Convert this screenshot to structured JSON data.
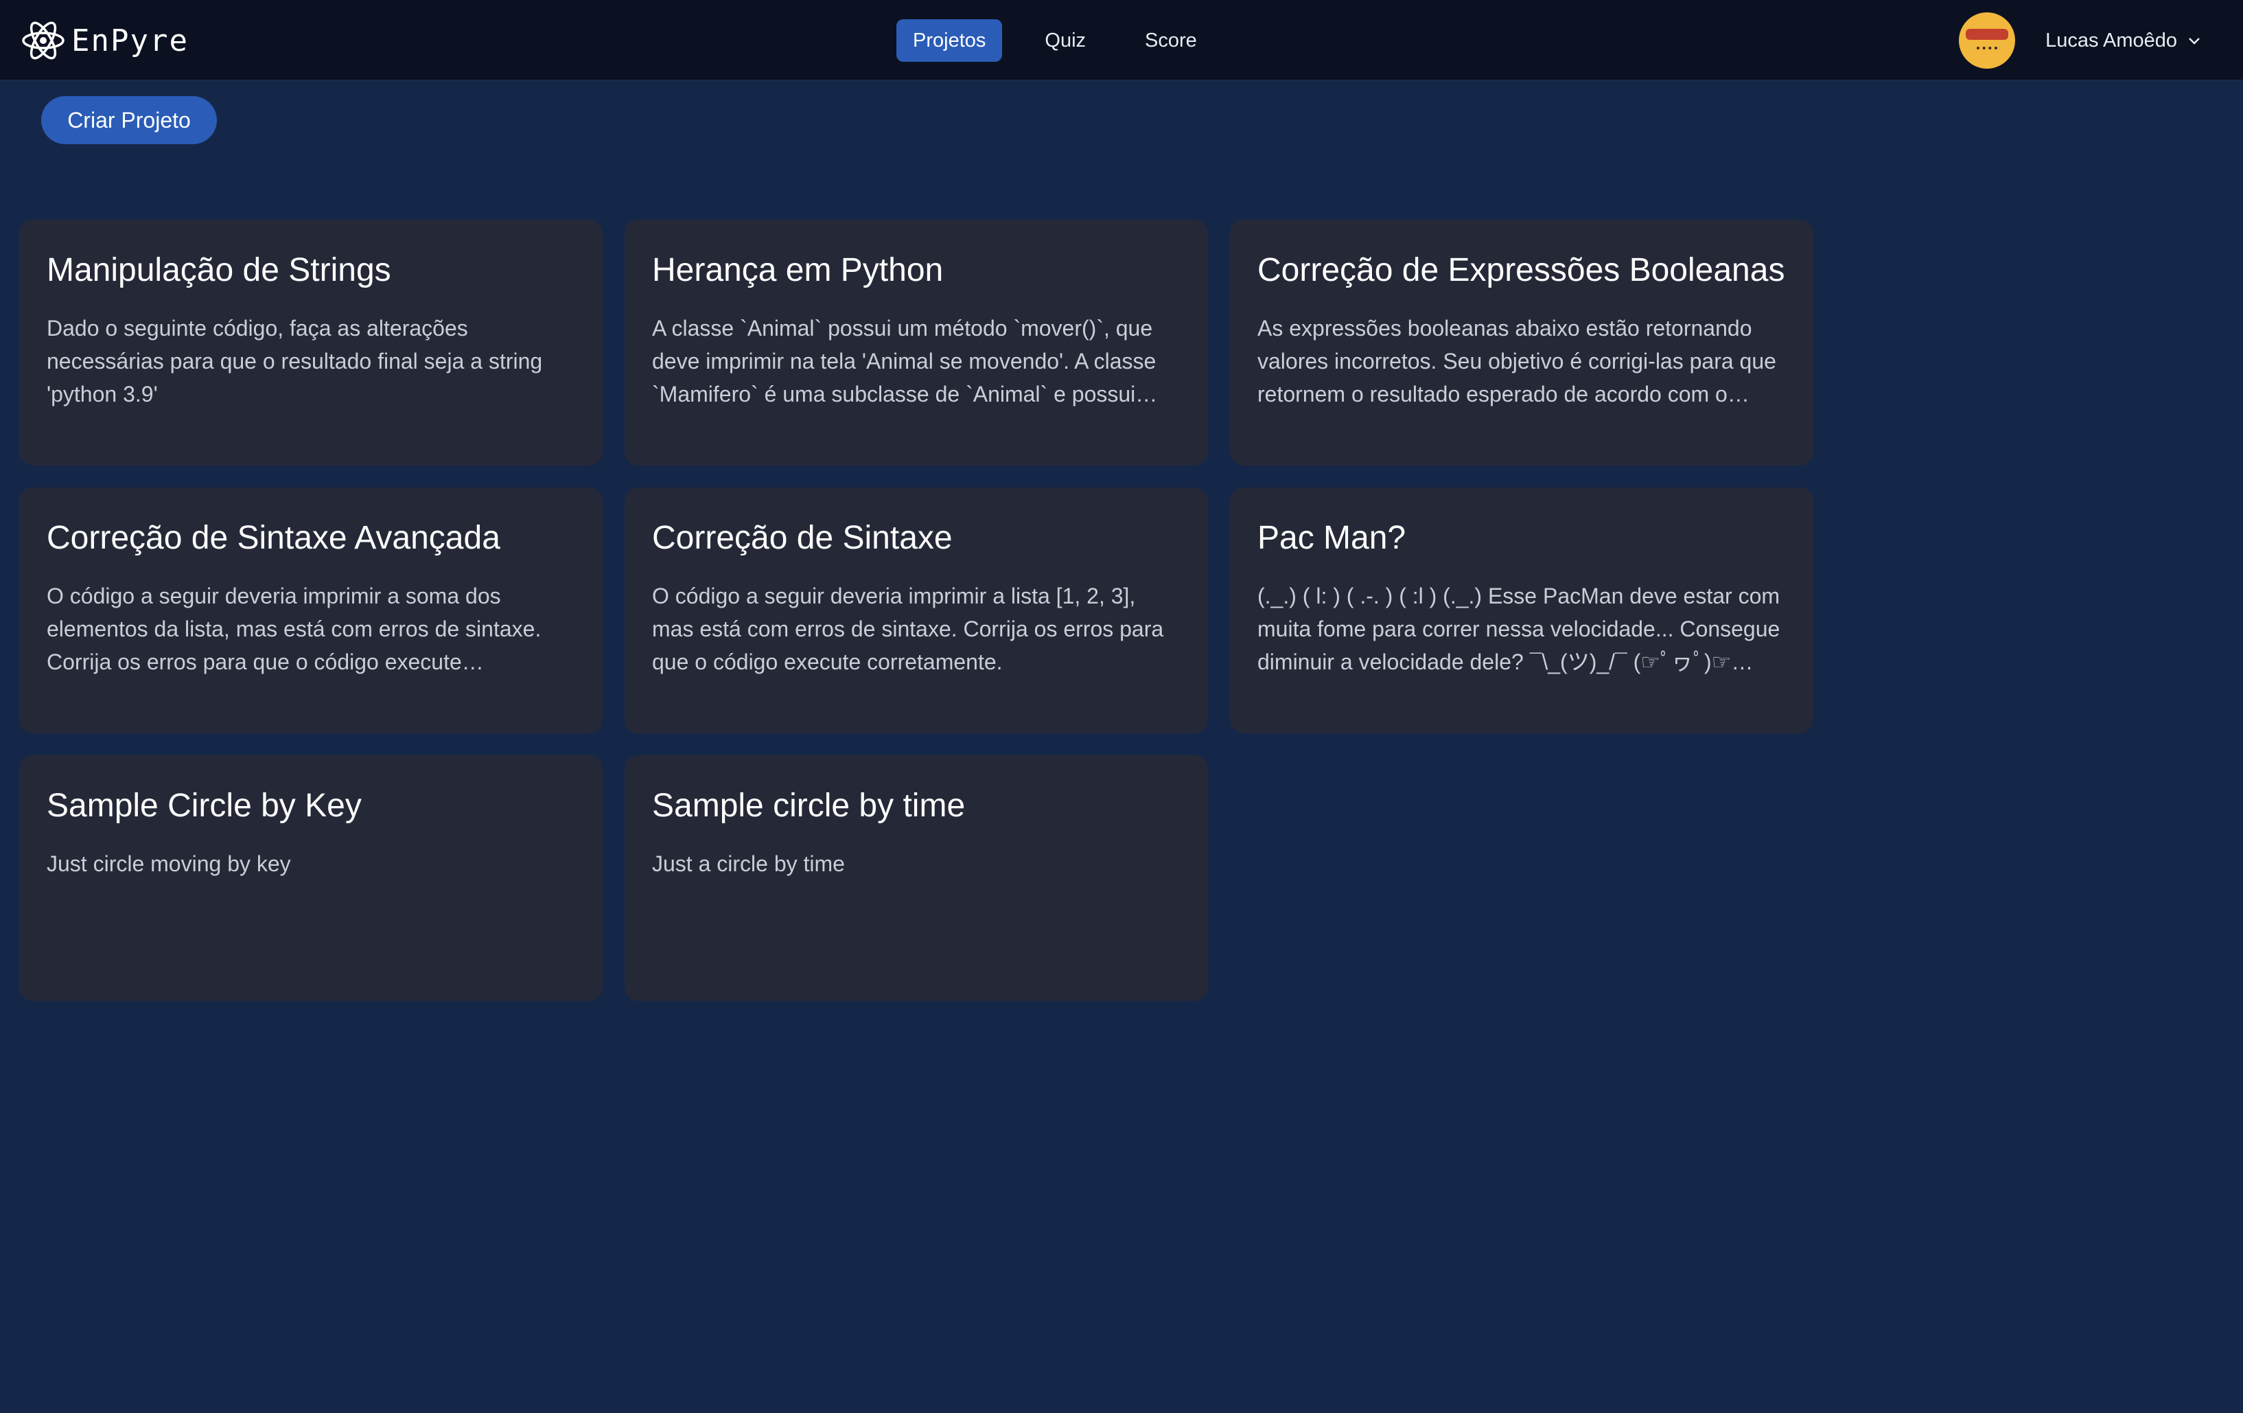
{
  "brand": {
    "name": "EnPyre"
  },
  "nav": {
    "links": [
      {
        "label": "Projetos",
        "active": true
      },
      {
        "label": "Quiz",
        "active": false
      },
      {
        "label": "Score",
        "active": false
      }
    ]
  },
  "user": {
    "name": "Lucas Amoêdo"
  },
  "actions": {
    "create_label": "Criar Projeto"
  },
  "projects": [
    {
      "title": "Manipulação de Strings",
      "description": "Dado o seguinte código, faça as alterações necessárias para que o resultado final seja a string 'python 3.9'"
    },
    {
      "title": "Herança em Python",
      "description": "A classe `Animal` possui um método `mover()`, que deve imprimir na tela 'Animal se movendo'. A classe `Mamifero` é uma subclasse de `Animal` e possui um…"
    },
    {
      "title": "Correção de Expressões Booleanas",
      "description": "As expressões booleanas abaixo estão retornando valores incorretos. Seu objetivo é corrigi-las para que retornem o resultado esperado de acordo com o…"
    },
    {
      "title": "Correção de Sintaxe Avançada",
      "description": "O código a seguir deveria imprimir a soma dos elementos da lista, mas está com erros de sintaxe. Corrija os erros para que o código execute…"
    },
    {
      "title": "Correção de Sintaxe",
      "description": "O código a seguir deveria imprimir a lista [1, 2, 3], mas está com erros de sintaxe. Corrija os erros para que o código execute corretamente."
    },
    {
      "title": "Pac Man?",
      "description": "(._.) ( l: ) ( .-. ) ( :l ) (._.) Esse PacMan deve estar com muita fome para correr nessa velocidade... Consegue diminuir a velocidade dele? ¯\\_(ツ)_/¯ (☞ﾟヮﾟ)☞ Dic…"
    },
    {
      "title": "Sample Circle by Key",
      "description": "Just circle moving by key"
    },
    {
      "title": "Sample circle by time",
      "description": "Just a circle by time"
    }
  ],
  "colors": {
    "background": "#152749",
    "navbar": "#0b1120",
    "accent": "#2b5cb7",
    "card": "#252937"
  }
}
